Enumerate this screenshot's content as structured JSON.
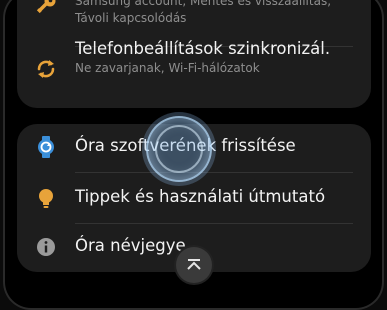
{
  "section_top": {
    "account_sub_line1": "Samsung account, Mentés és visszaállítás,",
    "account_sub_line2": "Távoli kapcsolódás",
    "sync_title": "Telefonbeállítások szinkronizál.",
    "sync_sub": "Ne zavarjanak, Wi-Fi-hálózatok"
  },
  "section_bottom": {
    "items": [
      {
        "label": "Óra szoftverének frissítése",
        "icon": "watch-update-icon"
      },
      {
        "label": "Tippek és használati útmutató",
        "icon": "lightbulb-icon"
      },
      {
        "label": "Óra névjegye",
        "icon": "info-icon"
      }
    ]
  },
  "scroll_top": {
    "icon": "scroll-to-top-icon"
  },
  "colors": {
    "key_icon": "#e8a33a",
    "sync_icon": "#e8a33a",
    "watch_icon": "#3b8fd9",
    "bulb_icon": "#e8a33a",
    "info_icon": "#9a9a9a"
  }
}
